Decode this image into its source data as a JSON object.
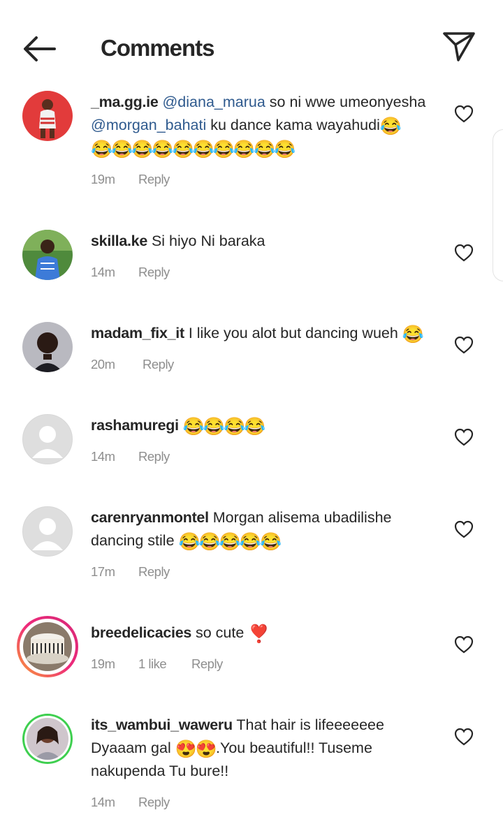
{
  "header": {
    "title": "Comments",
    "back_icon": "arrow-left-icon",
    "send_icon": "paper-plane-icon"
  },
  "comments": [
    {
      "username": "_ma.gg.ie",
      "mention1": "@diana_marua",
      "text1": "so ni wwe umeonyesha",
      "mention2": "@morgan_bahati",
      "text2": "ku dance kama wayahudi",
      "emoji1": "😂",
      "emoji2": "😂😂😂😂😂😂😂😂😂😂",
      "time": "19m",
      "reply": "Reply"
    },
    {
      "username": "skilla.ke",
      "text": "Si hiyo Ni baraka",
      "time": "14m",
      "reply": "Reply"
    },
    {
      "username": "madam_fix_it",
      "text": "I like you alot but dancing wueh",
      "emoji": "😂",
      "time": "20m",
      "reply": "Reply"
    },
    {
      "username": "rashamuregi",
      "emoji": "😂😂😂😂",
      "time": "14m",
      "reply": "Reply"
    },
    {
      "username": "carenryanmontel",
      "text": "Morgan alisema ubadilishe dancing stile",
      "emoji": "😂😂😂😂😂",
      "time": "17m",
      "reply": "Reply"
    },
    {
      "username": "breedelicacies",
      "text": "so cute",
      "emoji": "❣️",
      "time": "19m",
      "likes": "1 like",
      "reply": "Reply"
    },
    {
      "username": "its_wambui_waweru",
      "text1": "That hair is lifeeeeeee Dyaaam gal",
      "emoji": "😍😍",
      "text2": ".You beautiful!! Tuseme nakupenda Tu bure!!",
      "time": "14m",
      "reply": "Reply"
    }
  ],
  "colors": {
    "mention": "#2f5a8e",
    "meta": "#8e8e8e",
    "text": "#262626",
    "story_ring": "#ee2a7b",
    "close_friends_ring": "#3ecf4f"
  },
  "icons": {
    "like": "heart-outline-icon",
    "avatar_placeholder": "user-placeholder-icon"
  }
}
